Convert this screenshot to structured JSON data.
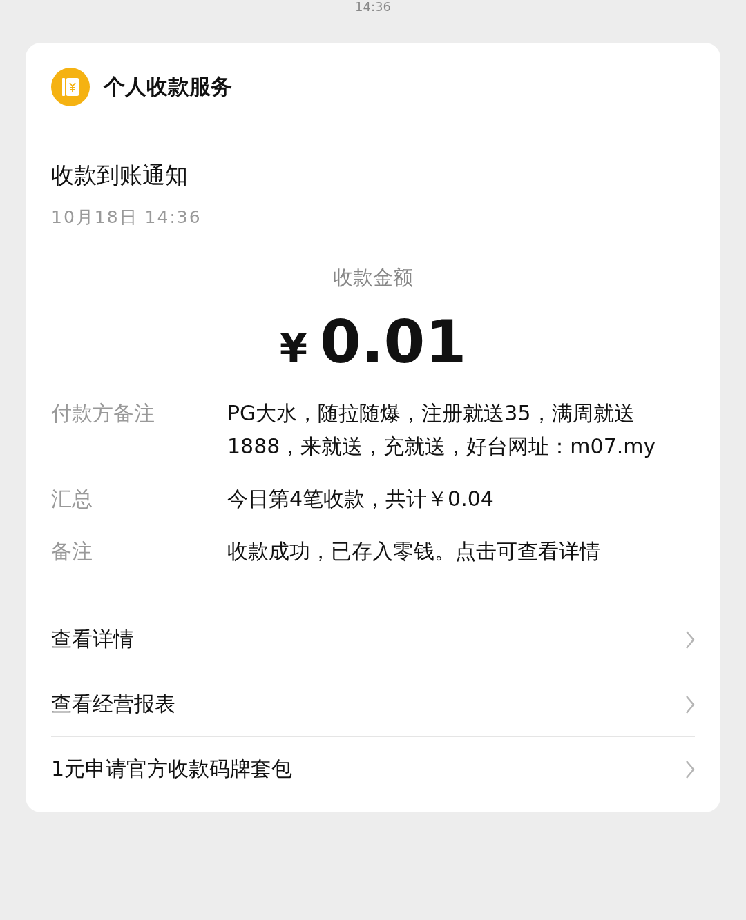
{
  "status_time": "14:36",
  "card": {
    "service_name": "个人收款服务",
    "title": "收款到账通知",
    "date": "10月18日 14:36",
    "amount_label": "收款金额",
    "currency": "¥",
    "amount": "0.01",
    "details": [
      {
        "label": "付款方备注",
        "value": "PG大水，随拉随爆，注册就送35，满周就送1888，来就送，充就送，好台网址：m07.my"
      },
      {
        "label": "汇总",
        "value": "今日第4笔收款，共计￥0.04"
      },
      {
        "label": "备注",
        "value": "收款成功，已存入零钱。点击可查看详情"
      }
    ],
    "links": [
      {
        "label": "查看详情"
      },
      {
        "label": "查看经营报表"
      },
      {
        "label": "1元申请官方收款码牌套包"
      }
    ]
  }
}
